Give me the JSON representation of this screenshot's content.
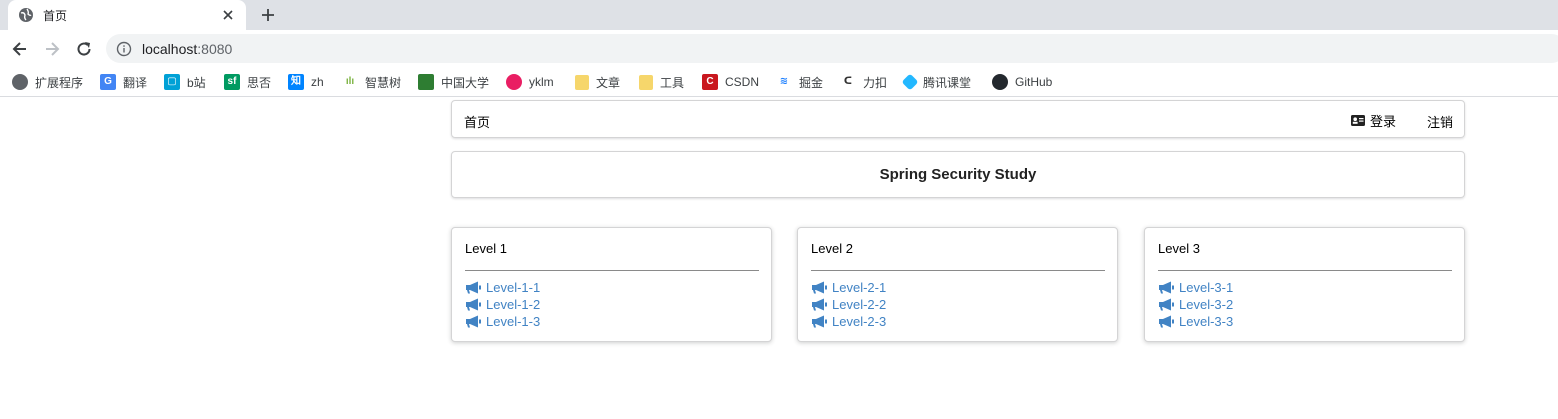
{
  "browser": {
    "tab_title": "首页",
    "url_host": "localhost",
    "url_port": ":8080",
    "bookmarks": [
      {
        "label": "扩展程序",
        "icon": "globe-icon",
        "color": "#5f6368"
      },
      {
        "label": "翻译",
        "icon": "google-translate-icon",
        "color": "#4285f4"
      },
      {
        "label": "b站",
        "icon": "bilibili-icon",
        "color": "#00a1d6"
      },
      {
        "label": "思否",
        "icon": "segmentfault-icon",
        "color": "#009a61"
      },
      {
        "label": "zh",
        "icon": "zhihu-icon",
        "color": "#0084ff"
      },
      {
        "label": "智慧树",
        "icon": "zhihuishu-icon",
        "color": "#7cb342"
      },
      {
        "label": "中国大学",
        "icon": "icourse-icon",
        "color": "#2e7d32"
      },
      {
        "label": "yklm",
        "icon": "yklm-icon",
        "color": "#e91e63"
      },
      {
        "label": "文章",
        "icon": "folder-icon",
        "color": "#f6d66b"
      },
      {
        "label": "工具",
        "icon": "folder-icon",
        "color": "#f6d66b"
      },
      {
        "label": "CSDN",
        "icon": "csdn-icon",
        "color": "#c9171e"
      },
      {
        "label": "掘金",
        "icon": "juejin-icon",
        "color": "#1e80ff"
      },
      {
        "label": "力扣",
        "icon": "leetcode-icon",
        "color": "#ffa116"
      },
      {
        "label": "腾讯课堂",
        "icon": "tencent-classroom-icon",
        "color": "#23b8ff"
      },
      {
        "label": "GitHub",
        "icon": "github-icon",
        "color": "#24292e"
      }
    ]
  },
  "menu": {
    "home_label": "首页",
    "login_label": "登录",
    "logout_label": "注销"
  },
  "title": "Spring Security Study",
  "cards": [
    {
      "title": "Level 1",
      "links": [
        "Level-1-1",
        "Level-1-2",
        "Level-1-3"
      ]
    },
    {
      "title": "Level 2",
      "links": [
        "Level-2-1",
        "Level-2-2",
        "Level-2-3"
      ]
    },
    {
      "title": "Level 3",
      "links": [
        "Level-3-1",
        "Level-3-2",
        "Level-3-3"
      ]
    }
  ],
  "colors": {
    "link": "#4183c4",
    "chrome_bg": "#dee1e6"
  }
}
